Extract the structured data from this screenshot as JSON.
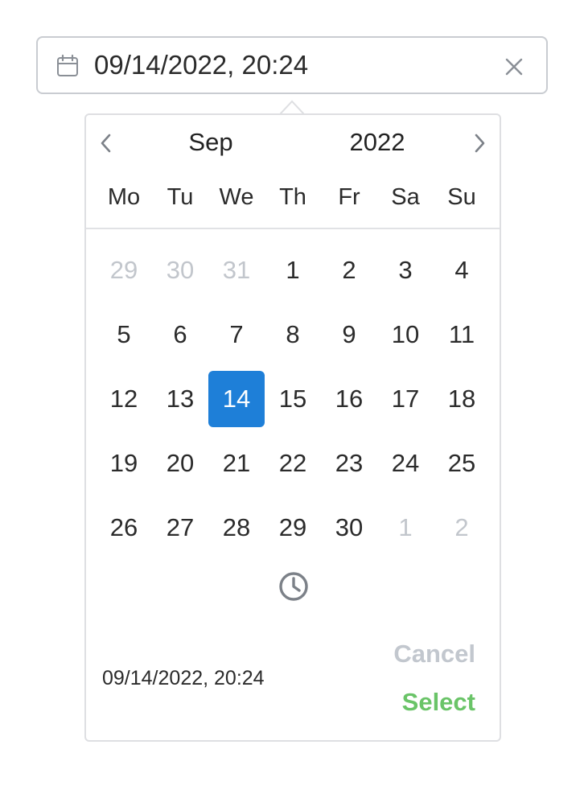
{
  "input": {
    "value": "09/14/2022, 20:24",
    "icon": "calendar-icon",
    "clear_icon": "close-icon"
  },
  "picker": {
    "month": "Sep",
    "year": "2022",
    "prev_icon": "chevron-left-icon",
    "next_icon": "chevron-right-icon",
    "weekdays": [
      "Mo",
      "Tu",
      "We",
      "Th",
      "Fr",
      "Sa",
      "Su"
    ],
    "weeks": [
      [
        {
          "d": "29",
          "m": true
        },
        {
          "d": "30",
          "m": true
        },
        {
          "d": "31",
          "m": true
        },
        {
          "d": "1"
        },
        {
          "d": "2"
        },
        {
          "d": "3"
        },
        {
          "d": "4"
        }
      ],
      [
        {
          "d": "5"
        },
        {
          "d": "6"
        },
        {
          "d": "7"
        },
        {
          "d": "8"
        },
        {
          "d": "9"
        },
        {
          "d": "10"
        },
        {
          "d": "11"
        }
      ],
      [
        {
          "d": "12"
        },
        {
          "d": "13"
        },
        {
          "d": "14",
          "s": true
        },
        {
          "d": "15"
        },
        {
          "d": "16"
        },
        {
          "d": "17"
        },
        {
          "d": "18"
        }
      ],
      [
        {
          "d": "19"
        },
        {
          "d": "20"
        },
        {
          "d": "21"
        },
        {
          "d": "22"
        },
        {
          "d": "23"
        },
        {
          "d": "24"
        },
        {
          "d": "25"
        }
      ],
      [
        {
          "d": "26"
        },
        {
          "d": "27"
        },
        {
          "d": "28"
        },
        {
          "d": "29"
        },
        {
          "d": "30"
        },
        {
          "d": "1",
          "m": true
        },
        {
          "d": "2",
          "m": true
        }
      ]
    ],
    "time_icon": "clock-icon",
    "footer_value": "09/14/2022, 20:24",
    "cancel_label": "Cancel",
    "select_label": "Select"
  },
  "colors": {
    "selected_bg": "#1e7fd8",
    "muted_text": "#c2c6cc",
    "select_green": "#6ac468",
    "cancel_gray": "#c2c7ce"
  }
}
